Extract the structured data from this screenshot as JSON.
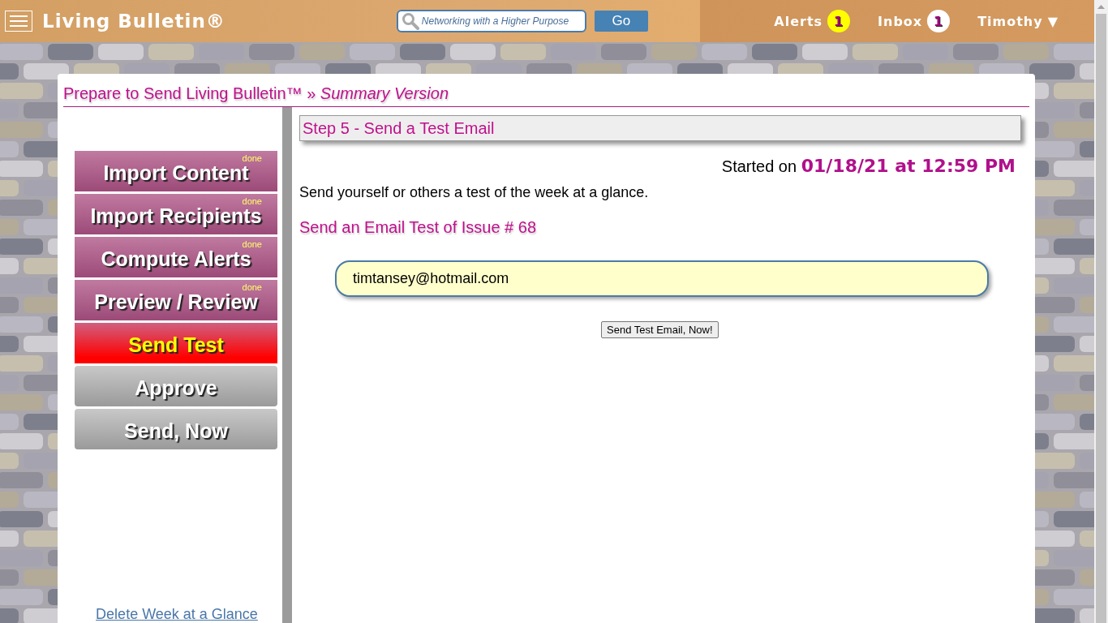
{
  "header": {
    "title": "Living Bulletin®",
    "search": {
      "placeholder": "Networking with a Higher Purpose"
    },
    "go_button": "Go",
    "nav": [
      {
        "label": "Alerts",
        "count": "1",
        "color": "#ffff00"
      },
      {
        "label": "Inbox",
        "count": "1",
        "color": "#ffffff"
      }
    ],
    "user": {
      "name": "Timothy",
      "caret": "▼"
    }
  },
  "page": {
    "title": "Prepare to Send Living Bulletin™ »",
    "subtitle": "Summary Version"
  },
  "steps": [
    {
      "label": "Import Content",
      "badge": "done",
      "kind": "done",
      "selected": false
    },
    {
      "label": "Import Recipients",
      "badge": "done",
      "kind": "done",
      "selected": false
    },
    {
      "label": "Compute Alerts",
      "badge": "done",
      "kind": "done",
      "selected": false
    },
    {
      "label": "Preview / Review",
      "badge": "done",
      "kind": "done",
      "selected": false
    },
    {
      "label": "Send Test",
      "kind": "current",
      "selected": true
    },
    {
      "label": "Approve",
      "kind": "pending",
      "selected": false
    },
    {
      "label": "Send, Now",
      "kind": "pending",
      "selected": false
    }
  ],
  "delete_link": "Delete Week at a Glance",
  "main": {
    "step_title": "Step 5 - Send a Test Email",
    "started_label": "Started on",
    "started_value": "01/18/21 at 12:59 PM",
    "description": "Send yourself or others a test of the week at a glance.",
    "section_title": "Send an Email Test of Issue # 68",
    "email": {
      "value": "timtansey@hotmail.com"
    },
    "send_button": "Send Test Email, Now!"
  }
}
